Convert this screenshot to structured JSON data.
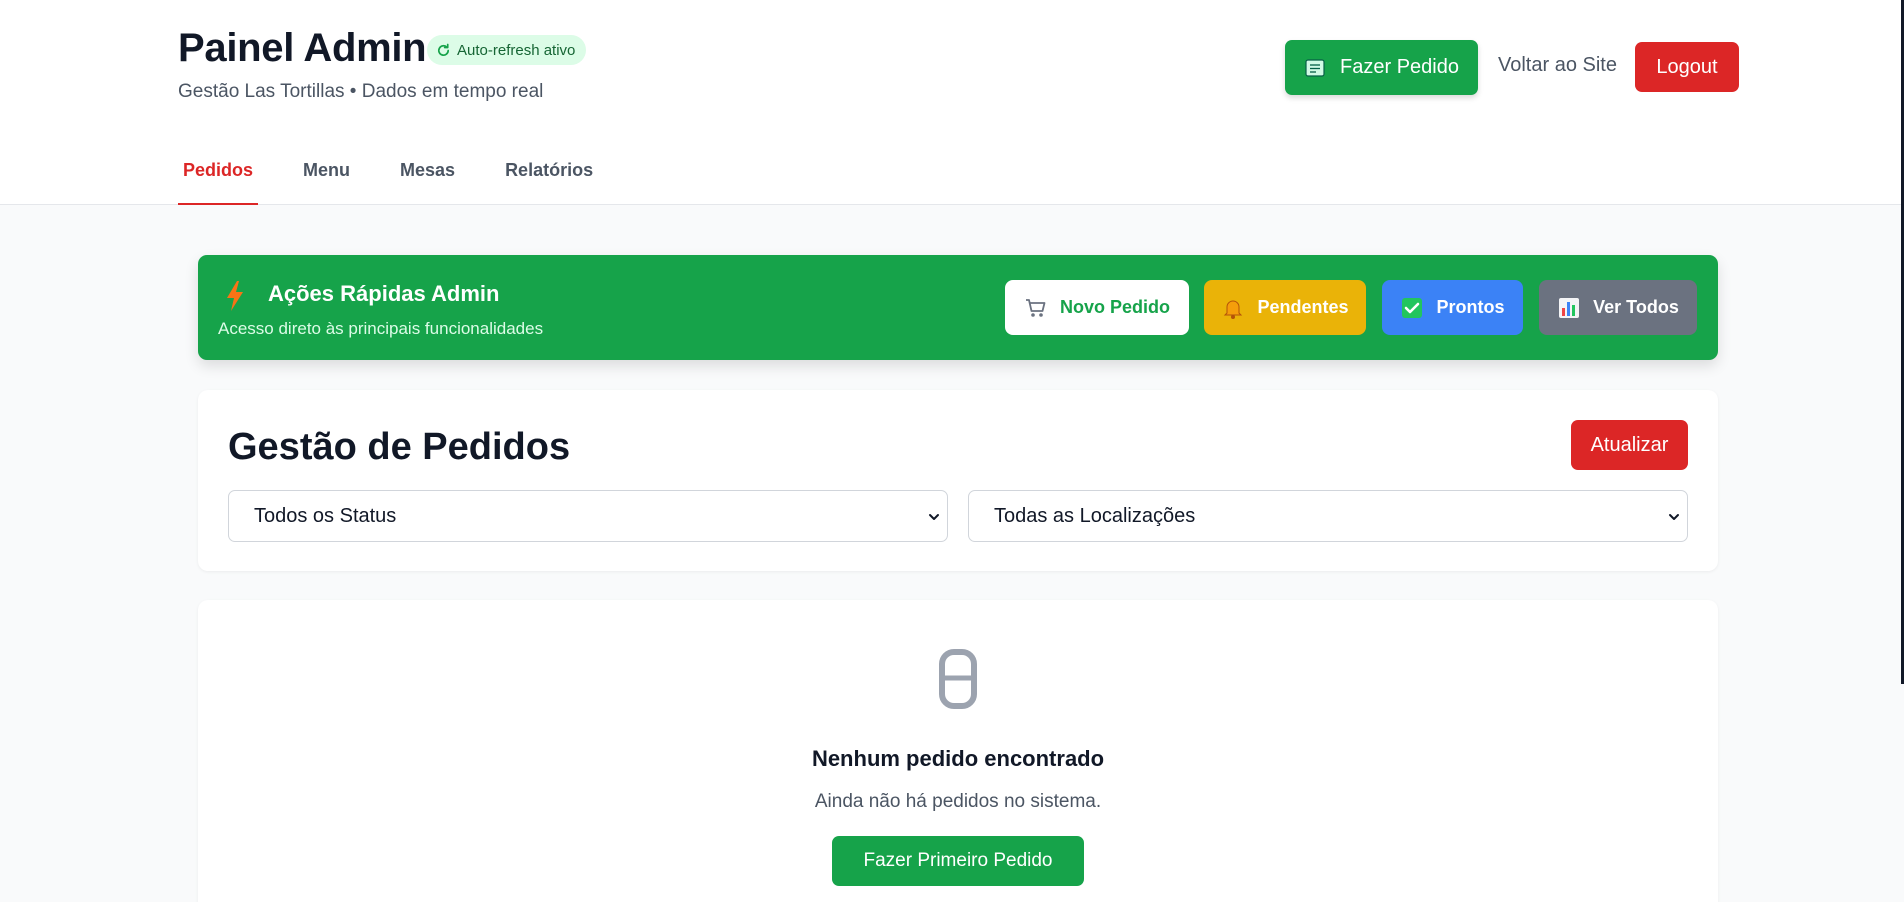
{
  "header": {
    "title": "Painel Admin",
    "autorefresh_label": "Auto-refresh ativo",
    "subtitle": "Gestão Las Tortillas • Dados em tempo real",
    "fazer_pedido_label": "Fazer Pedido",
    "voltar_label": "Voltar ao Site",
    "logout_label": "Logout"
  },
  "tabs": [
    {
      "label": "Pedidos",
      "active": true
    },
    {
      "label": "Menu",
      "active": false
    },
    {
      "label": "Mesas",
      "active": false
    },
    {
      "label": "Relatórios",
      "active": false
    }
  ],
  "quick_actions": {
    "title": "Ações Rápidas Admin",
    "subtitle": "Acesso direto às principais funcionalidades",
    "buttons": [
      {
        "label": "Novo Pedido",
        "icon": "cart-icon"
      },
      {
        "label": "Pendentes",
        "icon": "bell-icon"
      },
      {
        "label": "Prontos",
        "icon": "check-icon"
      },
      {
        "label": "Ver Todos",
        "icon": "chart-icon"
      }
    ]
  },
  "gestao": {
    "title": "Gestão de Pedidos",
    "atualizar_label": "Atualizar",
    "status_filter": "Todos os Status",
    "location_filter": "Todas as Localizações"
  },
  "empty_state": {
    "icon": "clipboard-icon",
    "title": "Nenhum pedido encontrado",
    "subtitle": "Ainda não há pedidos no sistema.",
    "button_label": "Fazer Primeiro Pedido"
  },
  "colors": {
    "primary_green": "#16a34a",
    "danger_red": "#dc2626",
    "warning_yellow": "#eab308",
    "info_blue": "#3b82f6",
    "neutral_gray": "#6b7280"
  }
}
